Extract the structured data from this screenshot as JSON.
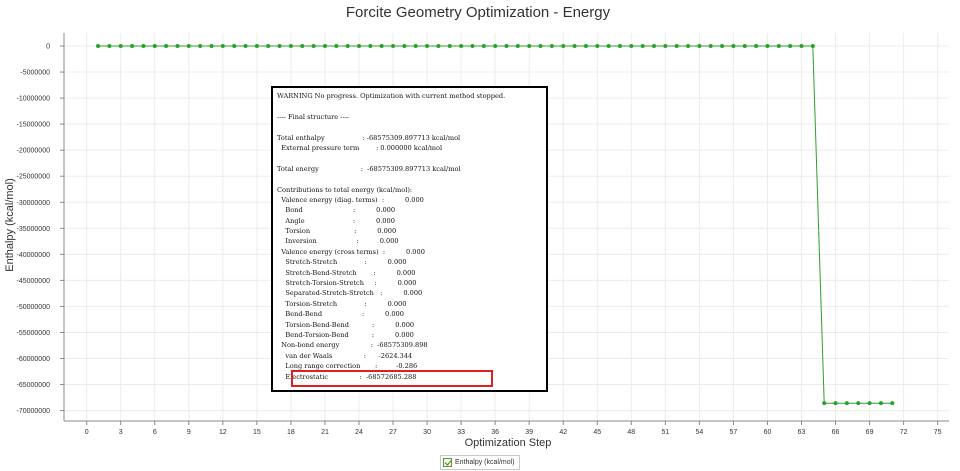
{
  "chart_data": {
    "type": "line",
    "title": "Forcite Geometry Optimization - Energy",
    "xlabel": "Optimization Step",
    "ylabel": "Enthalpy (kcal/mol)",
    "xlim": [
      -2,
      76
    ],
    "ylim": [
      -72000000,
      2500000
    ],
    "xticks": [
      0,
      3,
      6,
      9,
      12,
      15,
      18,
      21,
      24,
      27,
      30,
      33,
      36,
      39,
      42,
      45,
      48,
      51,
      54,
      57,
      60,
      63,
      66,
      69,
      72,
      75
    ],
    "yticks": [
      0,
      -5000000,
      -10000000,
      -15000000,
      -20000000,
      -25000000,
      -30000000,
      -35000000,
      -40000000,
      -45000000,
      -50000000,
      -55000000,
      -60000000,
      -65000000,
      -70000000
    ],
    "grid": true,
    "color": "#2ca02c",
    "legend": {
      "position": "bottom-center",
      "entries": [
        "Enthalpy (kcal/mol)"
      ]
    },
    "series": [
      {
        "name": "Enthalpy (kcal/mol)",
        "x": [
          1,
          2,
          3,
          4,
          5,
          6,
          7,
          8,
          9,
          10,
          11,
          12,
          13,
          14,
          15,
          16,
          17,
          18,
          19,
          20,
          21,
          22,
          23,
          24,
          25,
          26,
          27,
          28,
          29,
          30,
          31,
          32,
          33,
          34,
          35,
          36,
          37,
          38,
          39,
          40,
          41,
          42,
          43,
          44,
          45,
          46,
          47,
          48,
          49,
          50,
          51,
          52,
          53,
          54,
          55,
          56,
          57,
          58,
          59,
          60,
          61,
          62,
          63,
          64,
          65,
          66,
          67,
          68,
          69,
          70,
          71
        ],
        "y": [
          0,
          0,
          0,
          0,
          0,
          0,
          0,
          0,
          0,
          0,
          0,
          0,
          0,
          0,
          0,
          0,
          0,
          0,
          0,
          0,
          0,
          0,
          0,
          0,
          0,
          0,
          0,
          0,
          0,
          0,
          0,
          0,
          0,
          0,
          0,
          0,
          0,
          0,
          0,
          0,
          0,
          0,
          0,
          0,
          0,
          0,
          0,
          0,
          0,
          0,
          0,
          0,
          0,
          0,
          0,
          0,
          0,
          0,
          0,
          0,
          0,
          0,
          0,
          0,
          -68575310,
          -68575310,
          -68575310,
          -68575310,
          -68575310,
          -68575310,
          -68575310
        ]
      }
    ]
  },
  "log": {
    "lines": [
      "WARNING No progress. Optimization with current method stopped.",
      "",
      "---- Final structure ----",
      "",
      "Total enthalpy                  : -68575309.897713 kcal/mol",
      "  External pressure term        : 0.000000 kcal/mol",
      "",
      "Total energy                    :  -68575309.897713 kcal/mol",
      "",
      "Contributions to total energy (kcal/mol):",
      "  Valence energy (diag. terms)  :          0.000",
      "    Bond                        :          0.000",
      "    Angle                       :          0.000",
      "    Torsion                     :          0.000",
      "    Inversion                   :          0.000",
      "  Valence energy (cross terms)  :          0.000",
      "    Stretch-Stretch             :          0.000",
      "    Stretch-Bend-Stretch        :          0.000",
      "    Stretch-Torsion-Stretch     :          0.000",
      "    Separated-Stretch-Stretch   :          0.000",
      "    Torsion-Stretch             :          0.000",
      "    Bend-Bend                   :          0.000",
      "    Torsion-Bend-Bend           :          0.000",
      "    Bend-Torsion-Bend           :          0.000",
      "  Non-bond energy               :  -68575309.898",
      "    van der Waals               :      -2624.344",
      "    Long range correction       :         -0.286",
      "    Electrostatic               :  -68572685.288"
    ]
  }
}
